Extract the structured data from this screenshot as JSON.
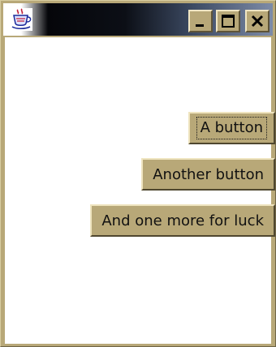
{
  "window": {
    "icon": "java-coffee-cup-icon",
    "controls": [
      "minimize-icon",
      "maximize-icon",
      "close-icon"
    ]
  },
  "buttons": [
    {
      "label": "A button",
      "focused": true
    },
    {
      "label": "Another button",
      "focused": false
    },
    {
      "label": "And one more for luck",
      "focused": false
    }
  ],
  "colors": {
    "frame": "#b8a878",
    "content_bg": "#ffffff",
    "titlebar_dark": "#05060a",
    "titlebar_light": "#7c8aa6"
  }
}
